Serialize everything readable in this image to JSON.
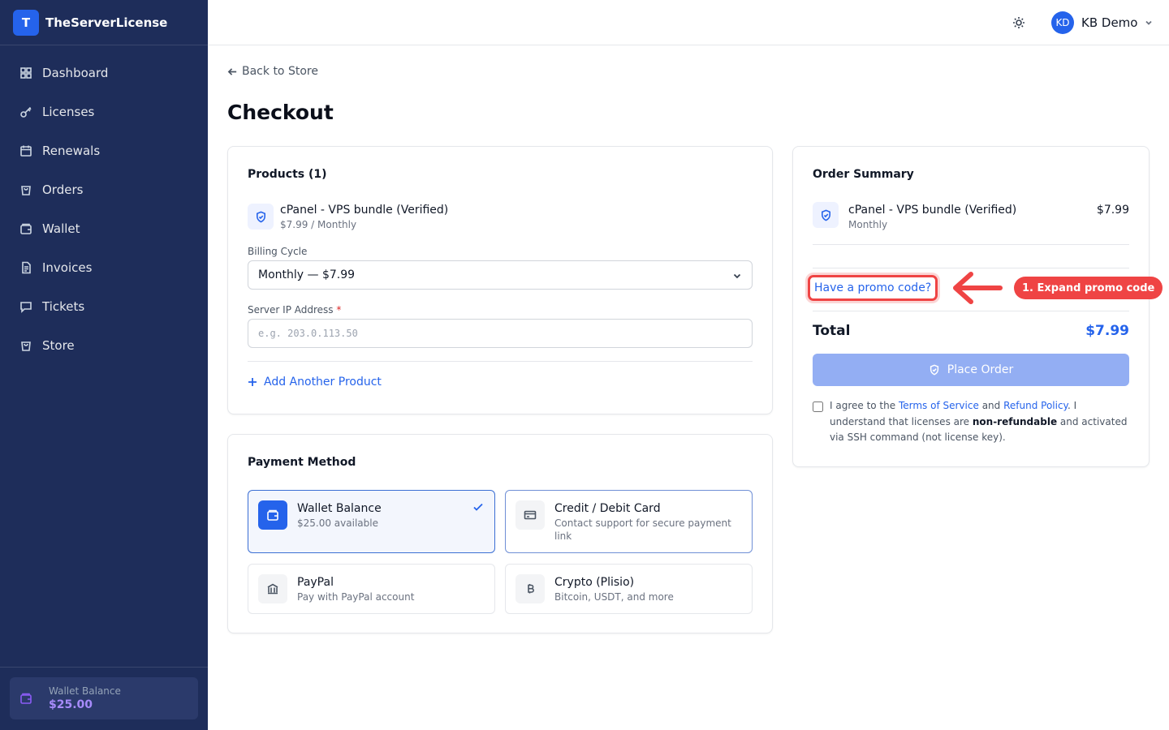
{
  "brand": {
    "logo_letter": "T",
    "name": "TheServerLicense",
    "accent": "#2563eb"
  },
  "sidebar": {
    "items": [
      {
        "label": "Dashboard",
        "icon": "grid-icon"
      },
      {
        "label": "Licenses",
        "icon": "key-icon"
      },
      {
        "label": "Renewals",
        "icon": "calendar-icon"
      },
      {
        "label": "Orders",
        "icon": "shopping-bag-icon"
      },
      {
        "label": "Wallet",
        "icon": "wallet-icon"
      },
      {
        "label": "Invoices",
        "icon": "file-text-icon"
      },
      {
        "label": "Tickets",
        "icon": "message-icon"
      },
      {
        "label": "Store",
        "icon": "store-bag-icon"
      }
    ],
    "wallet": {
      "label": "Wallet Balance",
      "value": "$25.00",
      "icon": "wallet-icon"
    },
    "background": "#1e2d5a"
  },
  "header": {
    "theme_icon": "sun-icon",
    "user": {
      "initials": "KD",
      "name": "KB Demo"
    }
  },
  "main": {
    "back_label": "Back to Store",
    "title": "Checkout",
    "products": {
      "title": "Products (1)",
      "item": {
        "name": "cPanel - VPS bundle (Verified)",
        "sub": "$7.99 / Monthly",
        "icon": "shield-check-icon"
      },
      "billing_label": "Billing Cycle",
      "billing_value": "Monthly — $7.99",
      "ip_label": "Server IP Address",
      "ip_required": "*",
      "ip_placeholder": "e.g. 203.0.113.50",
      "ip_value": "",
      "add_label": "Add Another Product"
    },
    "payment": {
      "title": "Payment Method",
      "methods": [
        {
          "name": "Wallet Balance",
          "desc": "$25.00 available",
          "icon": "wallet-icon",
          "state": "selected"
        },
        {
          "name": "Credit / Debit Card",
          "desc": "Contact support for secure payment link",
          "icon": "credit-card-icon",
          "state": "outlined"
        },
        {
          "name": "PayPal",
          "desc": "Pay with PayPal account",
          "icon": "bank-icon",
          "state": "default"
        },
        {
          "name": "Crypto (Plisio)",
          "desc": "Bitcoin, USDT, and more",
          "icon": "bitcoin-icon",
          "state": "default"
        }
      ]
    },
    "summary": {
      "title": "Order Summary",
      "item": {
        "name": "cPanel - VPS bundle (Verified)",
        "cycle": "Monthly",
        "price": "$7.99"
      },
      "promo_label": "Have a promo code?",
      "total_label": "Total",
      "total_value": "$7.99",
      "place_order_label": "Place Order",
      "terms": {
        "prefix": "I agree to the",
        "tos": "Terms of Service",
        "and": "and",
        "refund": "Refund Policy",
        "middle": ". I understand that licenses are",
        "bold": "non-refundable",
        "suffix": "and activated via SSH command (not license key)."
      }
    }
  },
  "annotation": {
    "label": "1. Expand promo code",
    "color": "#ef4444"
  }
}
